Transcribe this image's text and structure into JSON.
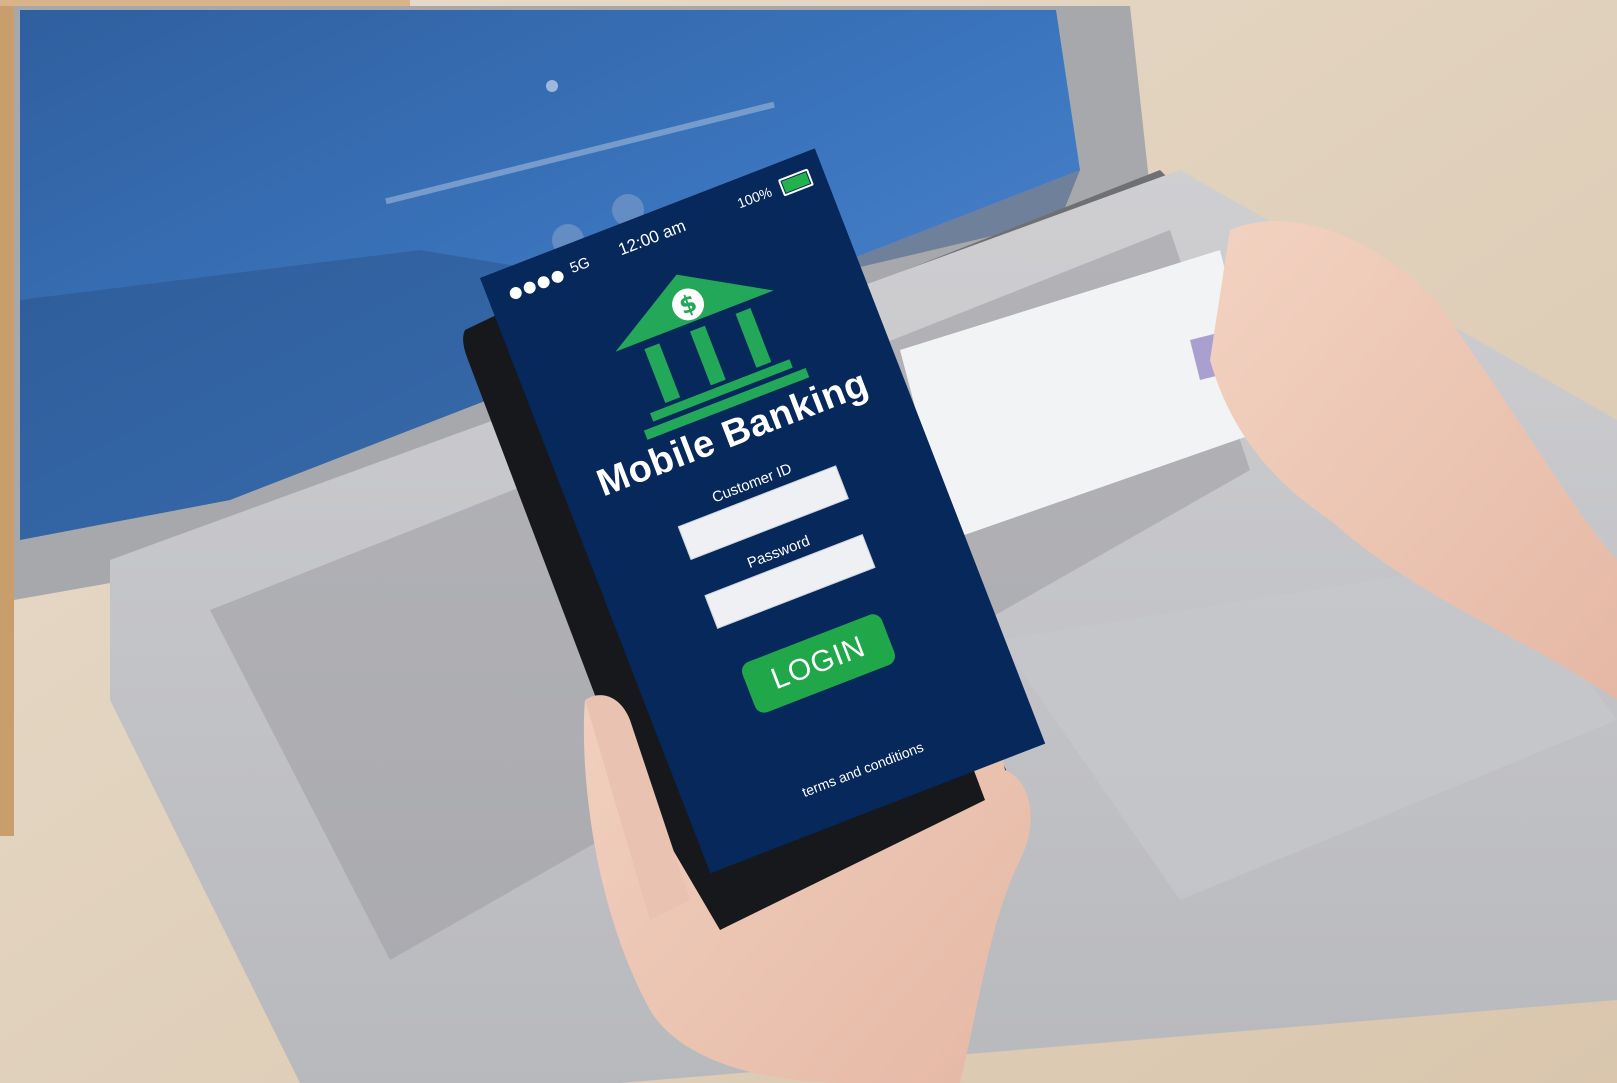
{
  "phone": {
    "status": {
      "network": "5G",
      "time": "12:00 am",
      "battery_text": "100%",
      "battery_level": 1.0
    },
    "icons": {
      "bank": "bank-building-dollar-icon"
    },
    "app_title": "Mobile Banking",
    "fields": {
      "customer_id_label": "Customer ID",
      "password_label": "Password"
    },
    "login_label": "LOGIN",
    "terms_label": "terms and conditions"
  },
  "colors": {
    "screen_bg": "#06285a",
    "accent_green": "#20a74a"
  }
}
